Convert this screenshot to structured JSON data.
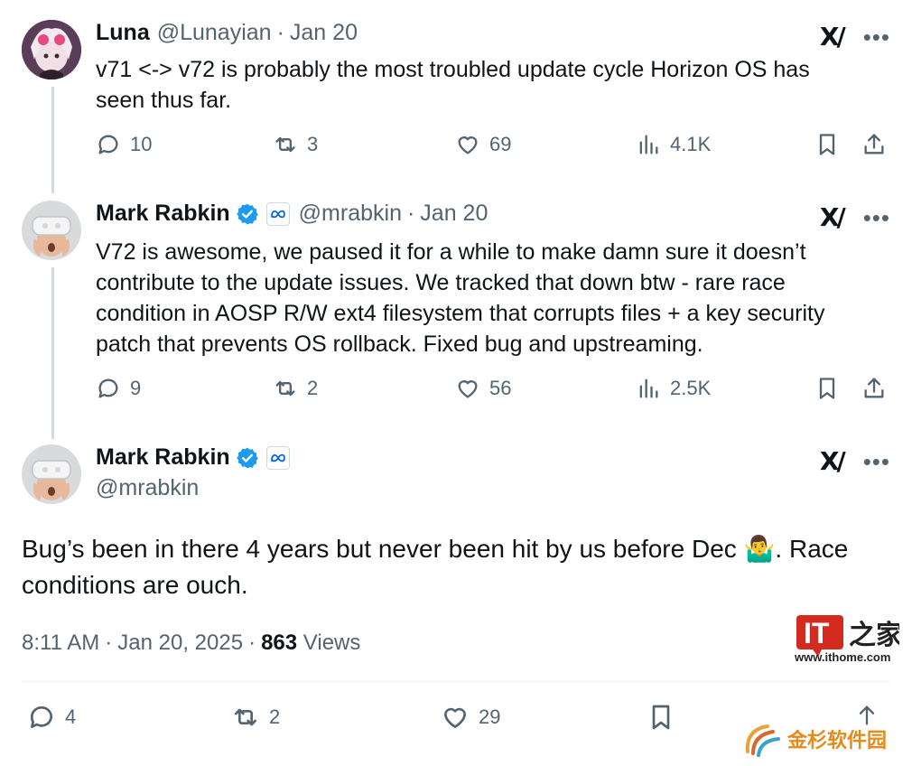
{
  "tweets": [
    {
      "name": "Luna",
      "handle": "@Lunayian",
      "sep": "·",
      "date": "Jan 20",
      "text_lines": [
        "v71 <-> v72 is probably the most troubled update cycle Horizon OS has",
        "seen thus far."
      ],
      "replies": "10",
      "retweets": "3",
      "likes": "69",
      "views": "4.1K"
    },
    {
      "name": "Mark Rabkin",
      "handle": "@mrabkin",
      "sep": "·",
      "date": "Jan 20",
      "text_lines": [
        "V72 is awesome, we paused it for a while to make damn sure it doesn’t",
        "contribute to the update issues. We tracked that down btw - rare race",
        "condition in AOSP R/W ext4 filesystem that corrupts files + a key security",
        "patch that prevents OS rollback. Fixed bug and upstreaming."
      ],
      "replies": "9",
      "retweets": "2",
      "likes": "56",
      "views": "2.5K"
    }
  ],
  "main": {
    "name": "Mark Rabkin",
    "handle": "@mrabkin",
    "text_line1": "Bug’s been in there 4 years but never been hit by us before Dec 🤷‍♂️. Race",
    "text_line2": "conditions are ouch.",
    "time": "8:11 AM",
    "sep": "·",
    "date": "Jan 20, 2025",
    "sep2": "·",
    "views_count": "863",
    "views_label": "Views",
    "replies": "4",
    "retweets": "2",
    "likes": "29"
  },
  "watermarks": {
    "it_logo": "IT之家",
    "url": "www.ithome.com",
    "jinshan": "金杉软件园"
  },
  "icons": {
    "more": "more-icon",
    "grok": "grok-icon",
    "verified_color": "#1d9bf0",
    "meta_color": "#0668e1"
  }
}
